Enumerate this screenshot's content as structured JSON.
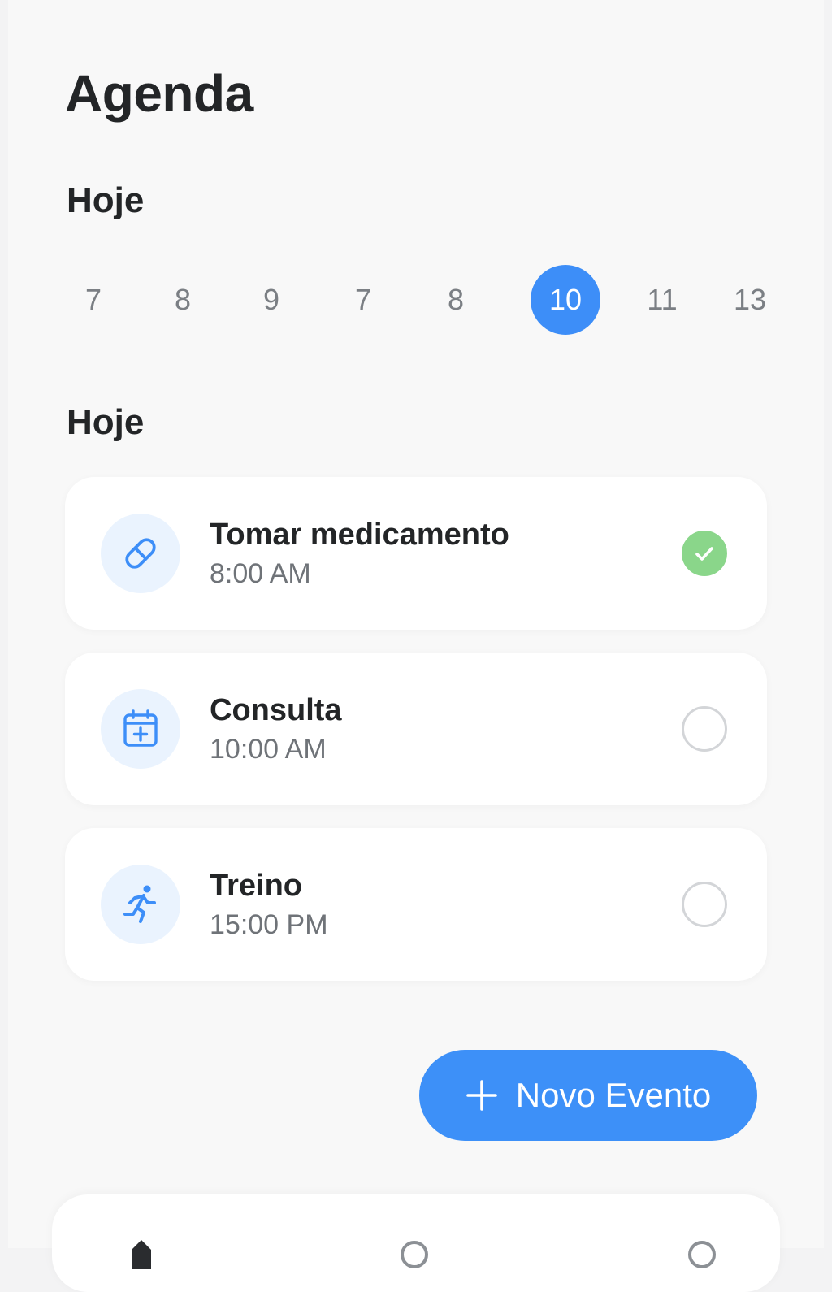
{
  "header": {
    "title": "Agenda"
  },
  "sections": {
    "calendar_title": "Hoje",
    "events_title": "Hoje"
  },
  "date_strip": {
    "days": [
      "7",
      "8",
      "9",
      "7",
      "8",
      "10",
      "11",
      "13"
    ],
    "selected": "10"
  },
  "events": [
    {
      "title": "Tomar medicamento",
      "time": "8:00 AM",
      "icon": "pill-icon",
      "done": true
    },
    {
      "title": "Consulta",
      "time": "10:00 AM",
      "icon": "calendar-plus-icon",
      "done": false
    },
    {
      "title": "Treino",
      "time": "15:00 PM",
      "icon": "running-icon",
      "done": false
    }
  ],
  "actions": {
    "new_event_label": "Novo Evento"
  },
  "colors": {
    "accent": "#3d8ef8",
    "icon_bg": "#eaf3fe",
    "done": "#8ad68a",
    "background": "#f8f8f8"
  },
  "bottom_nav": {
    "items": [
      "home-icon",
      "clock-icon",
      "profile-icon"
    ]
  }
}
